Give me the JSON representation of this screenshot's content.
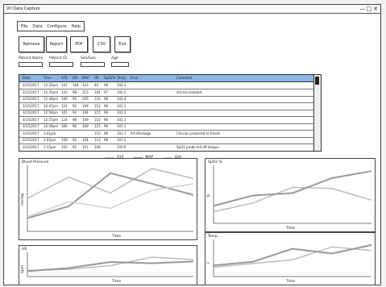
{
  "window": {
    "title": "Vit Data Capture",
    "controls": [
      "—",
      "□",
      "✕"
    ]
  },
  "menu": [
    "File",
    "Data",
    "Configure",
    "Help"
  ],
  "buttons": [
    "Retrieve",
    "Report",
    "PDF",
    "CSV",
    "Exit"
  ],
  "fields": {
    "patient_name": {
      "label": "Patient Name",
      "value": ""
    },
    "patient_id": {
      "label": "Patient ID",
      "value": ""
    },
    "sex": {
      "label": "Sex/Gen",
      "value": ""
    },
    "age": {
      "label": "Age",
      "value": ""
    }
  },
  "table": {
    "columns": [
      "Date",
      "Time",
      "SYS",
      "DIA",
      "MAP",
      "HR",
      "SpO2%",
      "Temp.",
      "Error",
      "Comment"
    ],
    "rows": [
      [
        "3/15/2017",
        "12:25pm",
        "141",
        "104",
        "123",
        "93",
        "98",
        "102.3",
        "",
        ""
      ],
      [
        "3/15/2017",
        "12:35pm",
        "143",
        "98",
        "115",
        "104",
        "97",
        "102.2",
        "",
        "Animal sedated"
      ],
      [
        "3/15/2017",
        "12:46pm",
        "106",
        "95",
        "105",
        "110",
        "98",
        "102.4",
        "",
        ""
      ],
      [
        "3/15/2017",
        "12:47pm",
        "124",
        "92",
        "109",
        "112",
        "96",
        "102.1",
        "",
        ""
      ],
      [
        "3/15/2017",
        "12:54pm",
        "105",
        "92",
        "104",
        "115",
        "99",
        "102.2",
        "",
        ""
      ],
      [
        "3/15/2017",
        "12:57pm",
        "124",
        "98",
        "109",
        "110",
        "96",
        "102.3",
        "",
        ""
      ],
      [
        "3/15/2017",
        "12:59pm",
        "106",
        "96",
        "109",
        "115",
        "96",
        "101.1",
        "",
        ""
      ],
      [
        "3/15/2017",
        "1:01pm",
        "",
        "",
        "",
        "110",
        "96",
        "101.7",
        "Art Blockage",
        "Clincian prepared to freeze"
      ],
      [
        "3/15/2017",
        "1:05pm",
        "106",
        "92",
        "104",
        "113",
        "98",
        "101.2",
        "",
        ""
      ],
      [
        "3/15/2017",
        "1:15pm",
        "103",
        "92",
        "101",
        "108",
        "",
        "100.9",
        "",
        "SpO2 probe fell off tongue"
      ]
    ]
  },
  "legend": [
    {
      "name": "SYS",
      "color": "#bbbbbb"
    },
    {
      "name": "MAP",
      "color": "#999999"
    },
    {
      "name": "DIA",
      "color": "#d0d0d0"
    }
  ],
  "chart_data": [
    {
      "type": "line",
      "title": "Blood Pressure",
      "xlabel": "Time",
      "ylabel": "mmHg",
      "x": [
        1,
        2,
        3,
        4,
        5
      ],
      "ylim": [
        0,
        100
      ],
      "series": [
        {
          "name": "SYS",
          "values": [
            50,
            82,
            58,
            95,
            80
          ]
        },
        {
          "name": "MAP",
          "values": [
            20,
            38,
            88,
            72,
            55
          ]
        },
        {
          "name": "DIA",
          "values": [
            22,
            45,
            35,
            62,
            72
          ]
        }
      ]
    },
    {
      "type": "line",
      "title": "SpO2 %",
      "xlabel": "Time",
      "ylabel": "%",
      "x": [
        1,
        2,
        3,
        4,
        5
      ],
      "ylim": [
        0,
        100
      ],
      "series": [
        {
          "values": [
            20,
            35,
            62,
            60,
            40
          ]
        },
        {
          "values": [
            30,
            48,
            52,
            78,
            90
          ]
        }
      ]
    },
    {
      "type": "line",
      "title": "HR",
      "xlabel": "Time",
      "ylabel": "bpm",
      "x": [
        1,
        2,
        3,
        4,
        5
      ],
      "ylim": [
        0,
        100
      ],
      "series": [
        {
          "values": [
            25,
            30,
            45,
            80,
            70
          ]
        },
        {
          "values": [
            22,
            35,
            60,
            55,
            62
          ]
        }
      ]
    },
    {
      "type": "line",
      "title": "Temp.",
      "xlabel": "Time",
      "ylabel": "F",
      "x": [
        1,
        2,
        3,
        4,
        5
      ],
      "ylim": [
        0,
        100
      ],
      "series": [
        {
          "values": [
            25,
            35,
            45,
            80,
            70
          ]
        },
        {
          "values": [
            30,
            40,
            75,
            62,
            85
          ]
        }
      ]
    }
  ]
}
